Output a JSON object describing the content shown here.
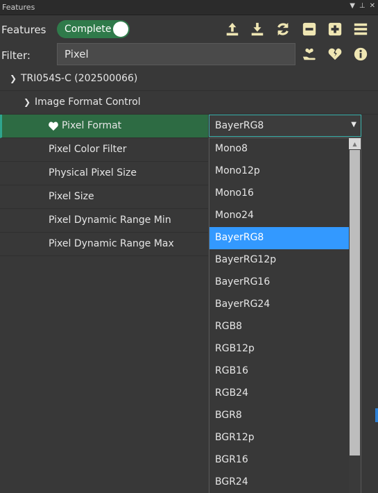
{
  "titlebar": {
    "title": "Features"
  },
  "toolbar": {
    "features_label": "Features",
    "toggle_label": "Complete",
    "icons": [
      "upload-icon",
      "download-icon",
      "refresh-icon",
      "collapse-all-icon",
      "expand-all-icon",
      "menu-icon"
    ]
  },
  "filter": {
    "label": "Filter:",
    "value": "Pixel",
    "icons": [
      "hand-heart-icon",
      "heart-broken-icon",
      "info-icon"
    ]
  },
  "tree": {
    "device": "TRI054S-C (202500066)",
    "category": "Image Format Control",
    "items": [
      {
        "label": "Pixel Format",
        "selected": true,
        "favorite": true
      },
      {
        "label": "Pixel Color Filter"
      },
      {
        "label": "Physical Pixel Size"
      },
      {
        "label": "Pixel Size"
      },
      {
        "label": "Pixel Dynamic Range Min"
      },
      {
        "label": "Pixel Dynamic Range Max"
      }
    ]
  },
  "pixel_format": {
    "value": "BayerRG8",
    "options": [
      "Mono8",
      "Mono12p",
      "Mono16",
      "Mono24",
      "BayerRG8",
      "BayerRG12p",
      "BayerRG16",
      "BayerRG24",
      "RGB8",
      "RGB12p",
      "RGB16",
      "RGB24",
      "BGR8",
      "BGR12p",
      "BGR16",
      "BGR24"
    ],
    "highlighted": "BayerRG8"
  },
  "colors": {
    "toggle_on": "#2f7a4a",
    "selection_row": "#2d6b43",
    "dropdown_highlight": "#3399ff",
    "icon_accent": "#efe6b3"
  }
}
